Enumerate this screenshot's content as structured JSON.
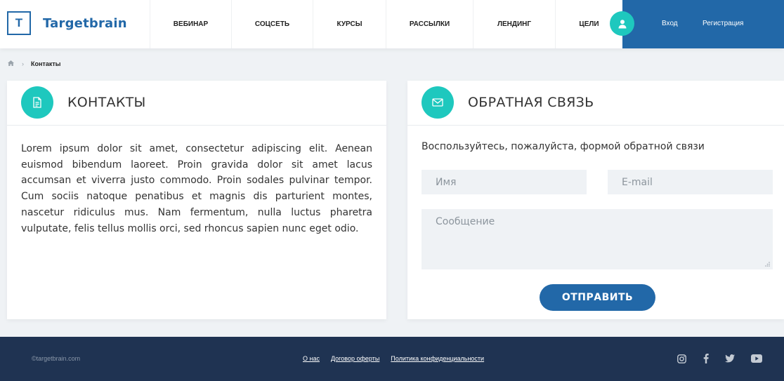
{
  "brand": {
    "logo_letter": "T",
    "name": "Targetbrain",
    "accent": "#2268a8",
    "teal": "#1ec8be"
  },
  "nav": {
    "items": [
      {
        "label": "ВЕБИНАР"
      },
      {
        "label": "СОЦСЕТЬ"
      },
      {
        "label": "КУРСЫ"
      },
      {
        "label": "РАССЫЛКИ"
      },
      {
        "label": "ЛЕНДИНГ"
      },
      {
        "label": "ЦЕЛИ"
      }
    ]
  },
  "auth": {
    "icon": "user-icon",
    "login": "Вход",
    "register": "Регистрация"
  },
  "breadcrumb": {
    "home_icon": "home-icon",
    "current": "Контакты"
  },
  "contacts": {
    "icon": "document-icon",
    "title": "КОНТАКТЫ",
    "text": "Lorem ipsum dolor sit amet, consectetur adipiscing elit. Aenean euismod bibendum laoreet. Proin gravida dolor sit amet lacus accumsan et viverra justo commodo. Proin sodales pulvinar tempor. Cum sociis natoque penatibus et magnis dis parturient montes, nascetur ridiculus mus. Nam fermentum, nulla luctus pharetra vulputate, felis tellus mollis orci, sed rhoncus sapien nunc eget odio."
  },
  "feedback": {
    "icon": "envelope-icon",
    "title": "ОБРАТНАЯ СВЯЗЬ",
    "intro": "Воспользуйтесь, пожалуйста, формой обратной связи",
    "name_placeholder": "Имя",
    "email_placeholder": "E-mail",
    "message_placeholder": "Сообщение",
    "submit_label": "ОТПРАВИТЬ"
  },
  "footer": {
    "copyright": "©targetbrain.com",
    "links": [
      "О нас",
      "Договор оферты",
      "Политика конфиденциальности"
    ],
    "social_icons": [
      "instagram-icon",
      "facebook-icon",
      "twitter-icon",
      "youtube-icon"
    ]
  }
}
